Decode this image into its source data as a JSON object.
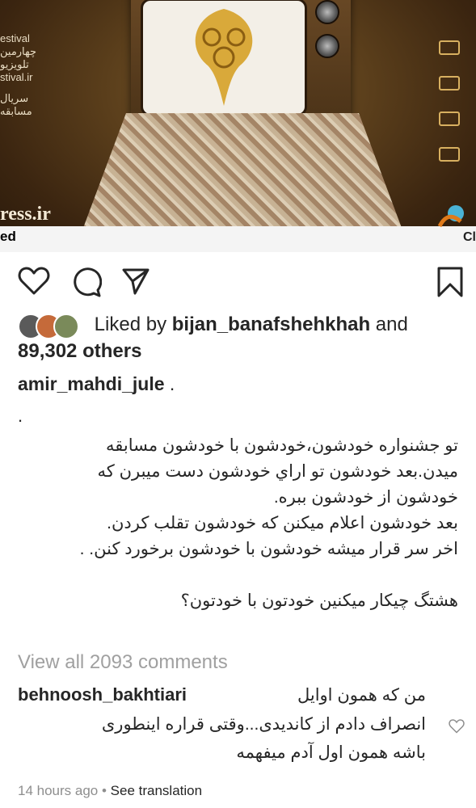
{
  "media": {
    "festival_lines": [
      "estival",
      "چهارمین",
      "تلویزیو",
      "stival.ir",
      "",
      "سریال",
      "مسابقه"
    ],
    "watermark": "ress.ir",
    "left_crop_text": "ed",
    "right_crop_text": "Cl",
    "colors": {
      "gold": "#d8b060",
      "frame": "#4a3217"
    }
  },
  "actions": {
    "like_icon": "heart-icon",
    "comment_icon": "comment-icon",
    "share_icon": "share-icon",
    "save_icon": "bookmark-icon"
  },
  "likes": {
    "prefix": "Liked by",
    "user": "bijan_banafshehkhah",
    "and": "and",
    "count": "89,302 others"
  },
  "post": {
    "author": "amir_mahdi_jule",
    "author_suffix": ".",
    "dot": ".",
    "caption": "تو جشنواره خودشون،خودشون با خودشون مسابقه\nمیدن.بعد خودشون تو اراي خودشون دست ميبرن که\nخودشون از خودشون ببره.\nبعد خودشون اعلام ميکنن که خودشون تقلب کردن.\nاخر سر قرار ميشه خودشون با خودشون برخورد کنن. .\n\nهشتگ چيکار ميکنين خودتون با خودتون؟"
  },
  "comments": {
    "view_all": "View all 2093 comments",
    "top": {
      "user": "behnoosh_bakhtiari",
      "line1": "من که همون اوايل",
      "rest": "انصراف دادم از کانديدی...وقتی قراره اينطوری\nباشه همون اول آدم ميفهمه"
    }
  },
  "meta": {
    "time": "14 hours ago",
    "separator": "•",
    "see_translation": "See translation"
  }
}
